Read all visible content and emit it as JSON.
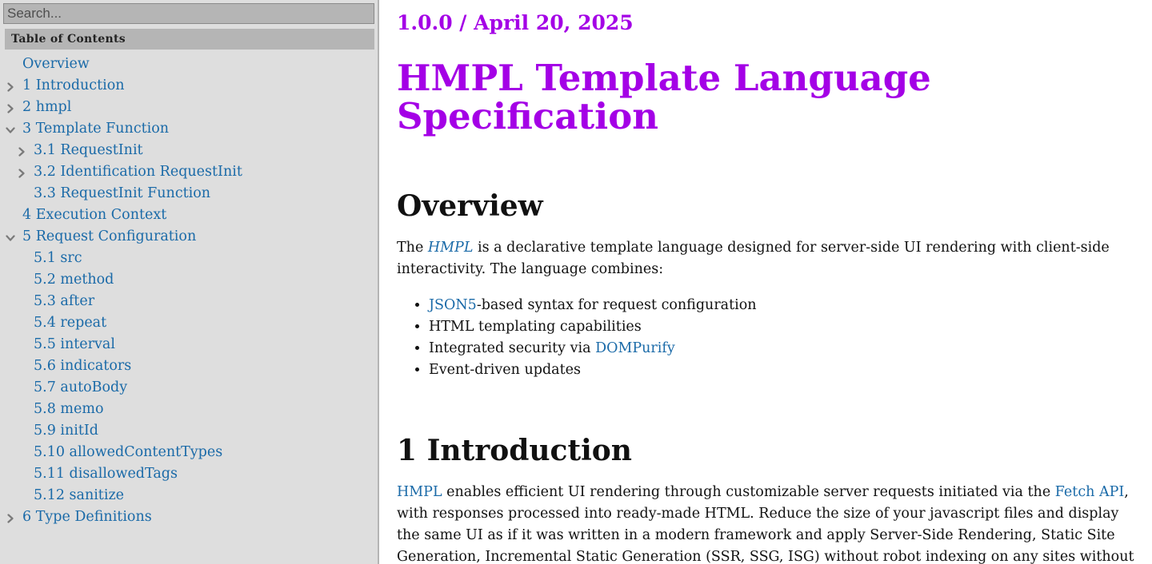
{
  "sidebar": {
    "search_placeholder": "Search...",
    "toc_title": "Table of Contents",
    "items": [
      {
        "label": "Overview",
        "level": 1,
        "chevron": "none"
      },
      {
        "label": "1 Introduction",
        "level": 1,
        "chevron": "right"
      },
      {
        "label": "2 hmpl",
        "level": 1,
        "chevron": "right"
      },
      {
        "label": "3 Template Function",
        "level": 1,
        "chevron": "down"
      },
      {
        "label": "3.1 RequestInit",
        "level": 2,
        "chevron": "right"
      },
      {
        "label": "3.2 Identification RequestInit",
        "level": 2,
        "chevron": "right"
      },
      {
        "label": "3.3 RequestInit Function",
        "level": 2,
        "chevron": "none"
      },
      {
        "label": "4 Execution Context",
        "level": 1,
        "chevron": "none"
      },
      {
        "label": "5 Request Configuration",
        "level": 1,
        "chevron": "down"
      },
      {
        "label": "5.1 src",
        "level": 2,
        "chevron": "none"
      },
      {
        "label": "5.2 method",
        "level": 2,
        "chevron": "none"
      },
      {
        "label": "5.3 after",
        "level": 2,
        "chevron": "none"
      },
      {
        "label": "5.4 repeat",
        "level": 2,
        "chevron": "none"
      },
      {
        "label": "5.5 interval",
        "level": 2,
        "chevron": "none"
      },
      {
        "label": "5.6 indicators",
        "level": 2,
        "chevron": "none"
      },
      {
        "label": "5.7 autoBody",
        "level": 2,
        "chevron": "none"
      },
      {
        "label": "5.8 memo",
        "level": 2,
        "chevron": "none"
      },
      {
        "label": "5.9 initId",
        "level": 2,
        "chevron": "none"
      },
      {
        "label": "5.10 allowedContentTypes",
        "level": 2,
        "chevron": "none"
      },
      {
        "label": "5.11 disallowedTags",
        "level": 2,
        "chevron": "none"
      },
      {
        "label": "5.12 sanitize",
        "level": 2,
        "chevron": "none"
      },
      {
        "label": "6 Type Definitions",
        "level": 1,
        "chevron": "right"
      }
    ]
  },
  "main": {
    "version": "1.0.0 / April 20, 2025",
    "title": "HMPL Template Language Specification",
    "overview": {
      "heading": "Overview",
      "p_before": "The ",
      "p_link": "HMPL",
      "p_after": " is a declarative template language designed for server-side UI rendering with client-side interactivity. The language combines:",
      "bullets": {
        "b1_link": "JSON5",
        "b1_text": "-based syntax for request configuration",
        "b2_text": "HTML templating capabilities",
        "b3_text": "Integrated security via ",
        "b3_link": "DOMPurify",
        "b4_text": "Event-driven updates"
      }
    },
    "intro": {
      "heading": "1 Introduction",
      "link1": "HMPL",
      "text1": " enables efficient UI rendering through customizable server requests initiated via the ",
      "link2": "Fetch API",
      "text2": ", with responses processed into ready-made HTML. Reduce the size of your javascript files and display the same UI as if it was written in a modern framework and apply Server-Side Rendering, Static Site Generation, Incremental Static Generation (SSR, SSG, ISG) without robot indexing on any sites without Next.js, Remix,"
    }
  },
  "colors": {
    "accent_purple": "#a400e6",
    "link_blue": "#1a6aa8",
    "sidebar_bg": "#dedede",
    "header_gray": "#b5b5b5"
  }
}
